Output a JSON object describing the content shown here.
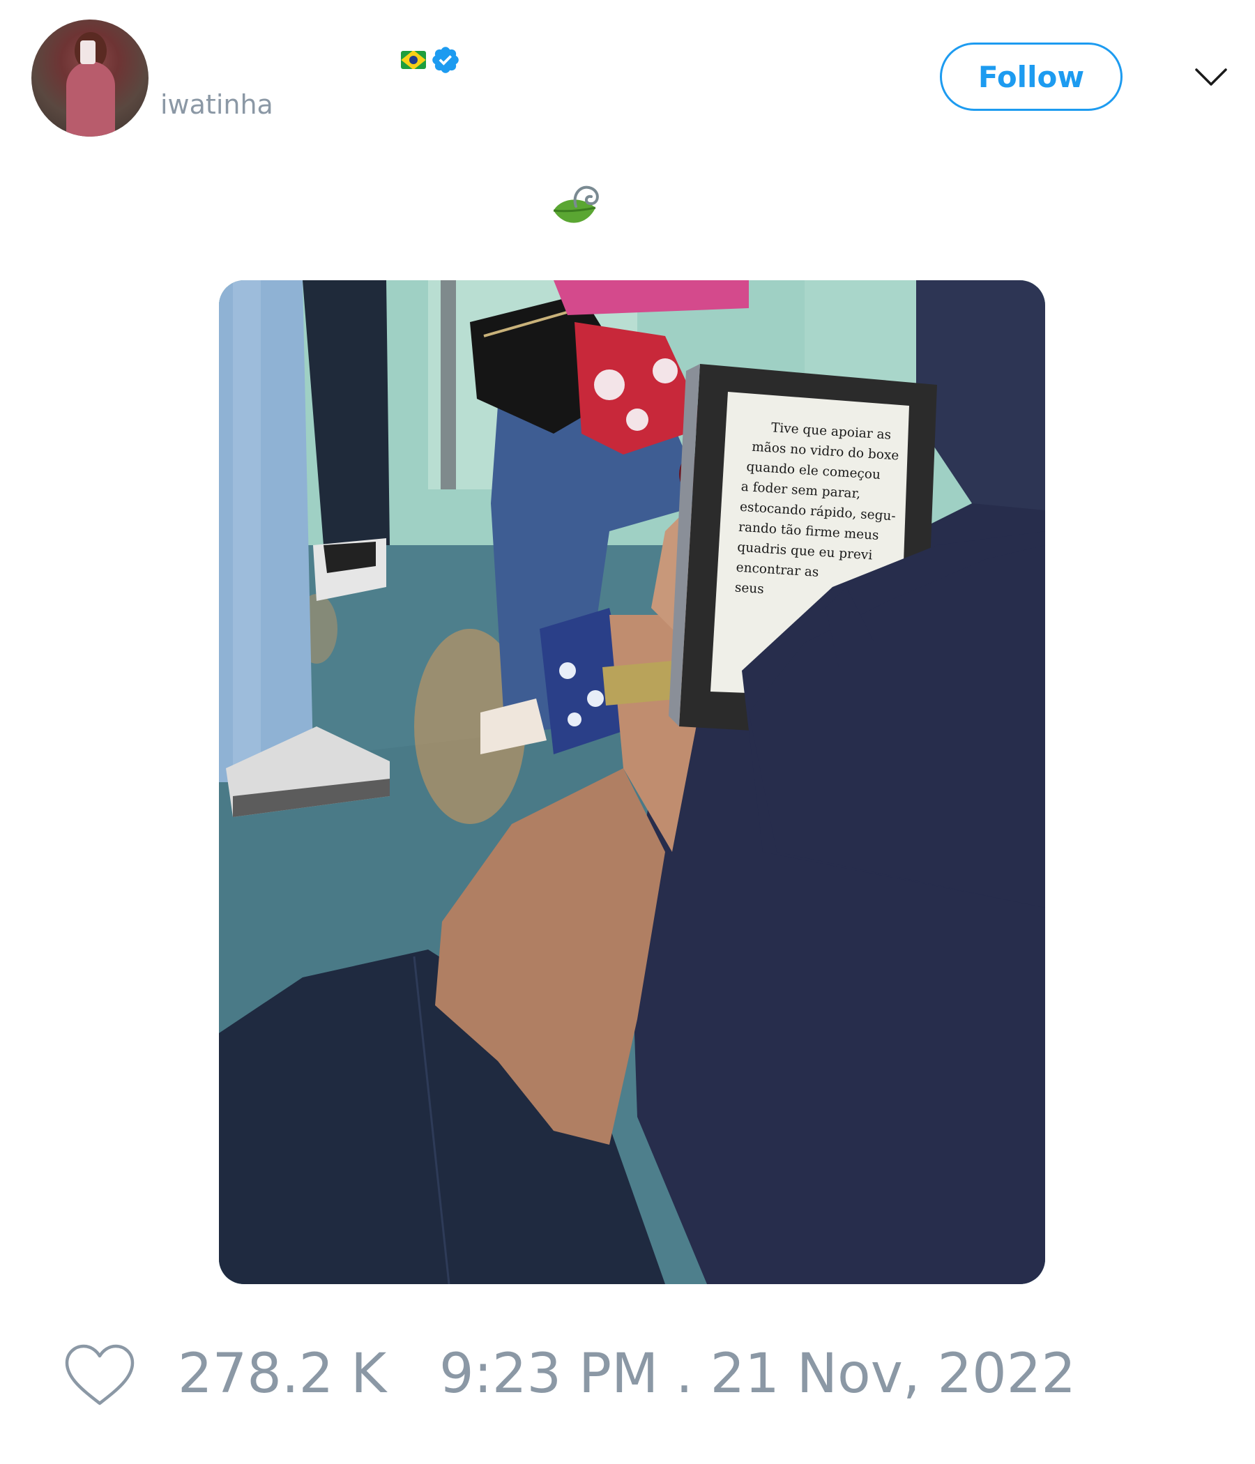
{
  "author": {
    "username": "iwatinha",
    "flag_icon": "brazil-flag-icon",
    "verified_icon": "verified-badge-icon"
  },
  "header": {
    "follow_label": "Follow",
    "menu_icon": "chevron-down-icon"
  },
  "tweet": {
    "text_icon": "leaf-emoji-icon"
  },
  "media": {
    "ereader_lines": [
      "Tive que apoiar as",
      "mãos no vidro do boxe",
      "quando ele começou",
      "a foder sem parar,",
      "estocando rápido, segu-",
      "rando tão firme meus",
      "quadris que eu previ",
      "encontrar as",
      "seus"
    ]
  },
  "footer": {
    "like_icon": "heart-icon",
    "like_count": "278.2 K",
    "timestamp": "9:23 PM . 21 Nov, 2022"
  },
  "colors": {
    "accent": "#1d9bf0",
    "muted_text": "#8b98a5"
  }
}
